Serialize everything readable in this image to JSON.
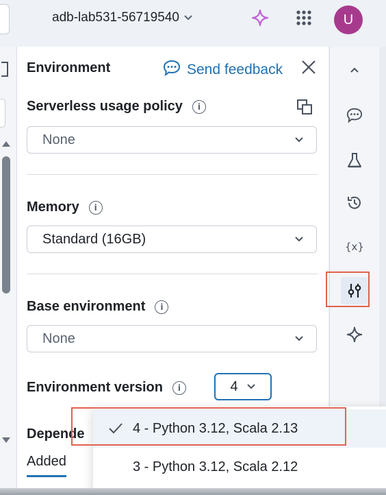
{
  "header": {
    "workspace_name": "adb-lab531-56719540",
    "avatar_initial": "U",
    "icons": [
      "chevron-down-icon",
      "sparkle-icon",
      "apps-grid-icon"
    ]
  },
  "panel": {
    "title": "Environment",
    "feedback_label": "Send feedback",
    "usage_policy": {
      "label": "Serverless usage policy",
      "value": "None"
    },
    "memory": {
      "label": "Memory",
      "value": "Standard (16GB)"
    },
    "base_env": {
      "label": "Base environment",
      "value": "None"
    },
    "env_version": {
      "label": "Environment version",
      "value": "4"
    },
    "dependencies": {
      "label": "Depende",
      "tab_added": "Added"
    }
  },
  "dropdown": {
    "options": [
      {
        "label": "4 - Python 3.12, Scala 2.13",
        "selected": true
      },
      {
        "label": "3 - Python 3.12, Scala 2.12",
        "selected": false
      }
    ]
  },
  "rail": {
    "icons": [
      "chevron-up-icon",
      "comment-icon",
      "experiment-flask-icon",
      "history-icon",
      "variables-icon",
      "environment-sliders-icon",
      "assistant-sparkle-icon"
    ],
    "active": "environment-sliders-icon"
  },
  "colors": {
    "accent": "#2272b4",
    "highlight": "#e0624e",
    "avatar": "#a83a8e",
    "sparkle": "#c060d8"
  }
}
